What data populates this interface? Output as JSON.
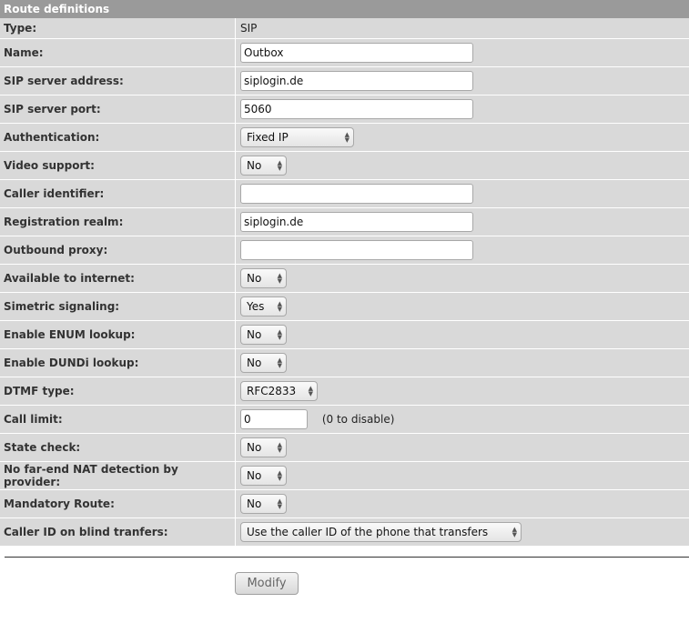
{
  "header": {
    "title": "Route definitions"
  },
  "type_row": {
    "label": "Type:",
    "value": "SIP"
  },
  "fields": {
    "name": {
      "label": "Name:",
      "value": "Outbox"
    },
    "sip_address": {
      "label": "SIP server address:",
      "value": "siplogin.de"
    },
    "sip_port": {
      "label": "SIP server port:",
      "value": "5060"
    },
    "authentication": {
      "label": "Authentication:",
      "value": "Fixed IP"
    },
    "video_support": {
      "label": "Video support:",
      "value": "No"
    },
    "caller_identifier": {
      "label": "Caller identifier:",
      "value": ""
    },
    "registration_realm": {
      "label": "Registration realm:",
      "value": "siplogin.de"
    },
    "outbound_proxy": {
      "label": "Outbound proxy:",
      "value": ""
    },
    "available_internet": {
      "label": "Available to internet:",
      "value": "No"
    },
    "simetric_signaling": {
      "label": "Simetric signaling:",
      "value": "Yes"
    },
    "enum_lookup": {
      "label": "Enable ENUM lookup:",
      "value": "No"
    },
    "dundi_lookup": {
      "label": "Enable DUNDi lookup:",
      "value": "No"
    },
    "dtmf_type": {
      "label": "DTMF type:",
      "value": "RFC2833"
    },
    "call_limit": {
      "label": "Call limit:",
      "value": "0",
      "hint": "(0 to disable)"
    },
    "state_check": {
      "label": "State check:",
      "value": "No"
    },
    "nat_detection": {
      "label": "No far-end NAT detection by provider:",
      "value": "No"
    },
    "mandatory_route": {
      "label": "Mandatory Route:",
      "value": "No"
    },
    "blind_transfer": {
      "label": "Caller ID on blind tranfers:",
      "value": "Use the caller ID of the phone that transfers"
    }
  },
  "actions": {
    "modify_label": "Modify"
  }
}
